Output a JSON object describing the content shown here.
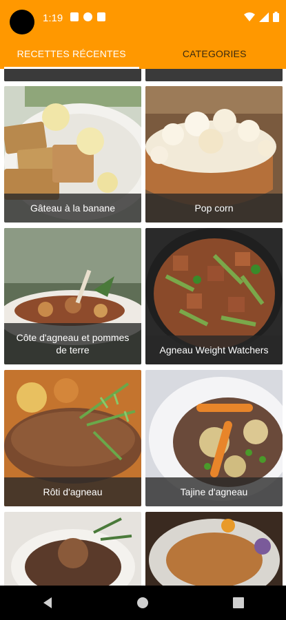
{
  "status_bar": {
    "time": "1:19"
  },
  "tabs": [
    {
      "label": "RECETTES RÉCENTES",
      "active": true
    },
    {
      "label": "CATEGORIES",
      "active": false
    }
  ],
  "recipes": [
    {
      "title": "Gâteau à la banane"
    },
    {
      "title": "Pop corn"
    },
    {
      "title": "Côte d'agneau et pommes de terre"
    },
    {
      "title": "Agneau Weight Watchers"
    },
    {
      "title": "Rôti d'agneau"
    },
    {
      "title": "Tajine d'agneau"
    }
  ],
  "colors": {
    "accent": "#ff9800",
    "caption_bg": "#282828",
    "nav_bar": "#000000"
  }
}
